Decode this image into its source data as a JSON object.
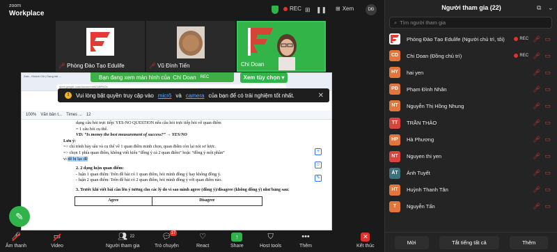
{
  "app": {
    "logo_top": "zoom",
    "logo_bottom": "Workplace"
  },
  "topbar": {
    "rec": "REC",
    "view": "Xem",
    "avatar_initials": "DĐ"
  },
  "video_tiles": [
    {
      "name": "Phòng Đào Tạo Edulife"
    },
    {
      "name": "Vũ Đình Tiến"
    },
    {
      "name": "Chi Doan"
    }
  ],
  "share": {
    "banner": "Bạn đang xem màn hình của",
    "presenter": "Chi Doan",
    "rec": "REC",
    "view_option": "Xem tùy chọn"
  },
  "browser": {
    "tabs": "Zalo - Khánh Chi | Dạng bài ...",
    "url": "docs.google.com/document/d/1WR9Ov..."
  },
  "doc_toolbar": {
    "zoom": "100%",
    "style": "Văn bản t...",
    "font": "Times ...",
    "size": "12"
  },
  "toast": {
    "pre": "Vui lòng bật quyền truy cập vào",
    "mic": "micrô",
    "and": "và",
    "camera": "camera",
    "post": "của bạn để có trải nghiệm tốt nhất."
  },
  "doc": {
    "l1": "dạng câu hỏi trực tiếp: YES-NO QUESTION nếu câu hỏi trực tiếp hỏi về quan điểm",
    "l2": "= 1 câu hỏi cụ thể.",
    "l3": "VD: “Is money the best measurement of success?” → YES/NO",
    "l4": "Lưu ý:",
    "l5": "=> chỉ trình bày sâu và cụ thể về 1 quan điểm minh chọn, quan điểm còn lại nói sơ lược.",
    "l6": "=> chọn 1 phía quan điểm, không viết kiểu “đồng ý cả 2 quan điểm” hoặc “đồng ý một phần”",
    "l7a": "vì",
    "l7b": "dễ bị lạc đề",
    "l8": "2. 2 dạng luận quan điểm:",
    "l9": "- luận 1 quan điểm: Trên đề bài có 1 quan điểm, hỏi mình đồng ý hay không đồng ý.",
    "l10": "- luận 2 quan điểm: Trên đề bài có 2 quan điểm, hỏi mình đồng ý với quan điểm nào.",
    "l11": "3. Trước khi viết bài cần lên ý tưởng cho các lý do vì sao mình agree (đồng ý)/disagree (không đồng ý) như bảng sau:",
    "table_headers": [
      "Agree",
      "Disagree"
    ]
  },
  "toolbar": {
    "audio": "Âm thanh",
    "video": "Video",
    "participants": "Người tham gia",
    "participants_count": "22",
    "chat": "Trò chuyện",
    "chat_badge": "17",
    "react": "React",
    "share": "Share",
    "host_tools": "Host tools",
    "more": "Thêm",
    "end": "Kết thúc"
  },
  "panel": {
    "title": "Người tham gia (22)",
    "search_placeholder": "Tìm người tham gia",
    "participants": [
      {
        "initials": "",
        "name": "Phòng Đào Tạo Edulife (Người chủ trì, tôi)",
        "color": "#ffffff",
        "rec": "REC",
        "logo": true
      },
      {
        "initials": "CD",
        "name": "Chi Doan (Đồng chủ trì)",
        "color": "#e3743a",
        "rec": "REC"
      },
      {
        "initials": "HY",
        "name": "hai yen",
        "color": "#e3743a"
      },
      {
        "initials": "PĐ",
        "name": "Phạm Đình Nhân",
        "color": "#e3743a"
      },
      {
        "initials": "NT",
        "name": "Nguyễn Thị Hồng Nhung",
        "color": "#e3743a"
      },
      {
        "initials": "TT",
        "name": "TRẦN THẢO",
        "color": "#d9453d"
      },
      {
        "initials": "HP",
        "name": "Hà Phương",
        "color": "#e3743a"
      },
      {
        "initials": "NT",
        "name": "Nguyen thi yen",
        "color": "#d9453d"
      },
      {
        "initials": "ÁT",
        "name": "Ánh Tuyết",
        "color": "#3d6f7d"
      },
      {
        "initials": "HT",
        "name": "Huỳnh Thanh Tân",
        "color": "#e3743a"
      },
      {
        "initials": "T",
        "name": "Nguyễn Tấn",
        "color": "#e3743a"
      }
    ],
    "invite": "Mời",
    "mute_all": "Tắt tiếng tất cả",
    "more": "Thêm"
  }
}
